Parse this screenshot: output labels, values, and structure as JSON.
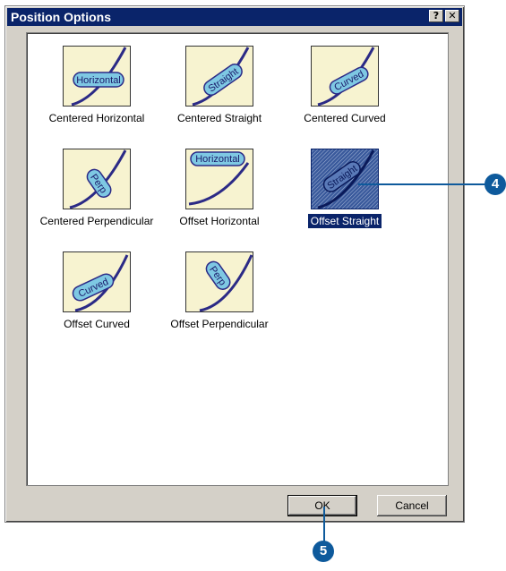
{
  "window": {
    "title": "Position Options",
    "help_label": "?",
    "close_label": "✕"
  },
  "options": [
    {
      "label": "Centered Horizontal",
      "tag": "Horizontal",
      "selected": false
    },
    {
      "label": "Centered Straight",
      "tag": "Straight",
      "selected": false
    },
    {
      "label": "Centered Curved",
      "tag": "Curved",
      "selected": false
    },
    {
      "label": "Centered Perpendicular",
      "tag": "Perp",
      "selected": false
    },
    {
      "label": "Offset Horizontal",
      "tag": "Horizontal",
      "selected": false
    },
    {
      "label": "Offset Straight",
      "tag": "Straight",
      "selected": true
    },
    {
      "label": "Offset Curved",
      "tag": "Curved",
      "selected": false
    },
    {
      "label": "Offset Perpendicular",
      "tag": "Perp",
      "selected": false
    }
  ],
  "buttons": {
    "ok_label": "OK",
    "cancel_label": "Cancel"
  },
  "callouts": {
    "step_a": "4",
    "step_b": "5"
  },
  "colors": {
    "titlebar": "#0a246a",
    "thumb_bg": "#f7f3d0",
    "label_fill": "#7ec8e3",
    "line": "#2b2a86",
    "callout": "#0e5a9c"
  }
}
